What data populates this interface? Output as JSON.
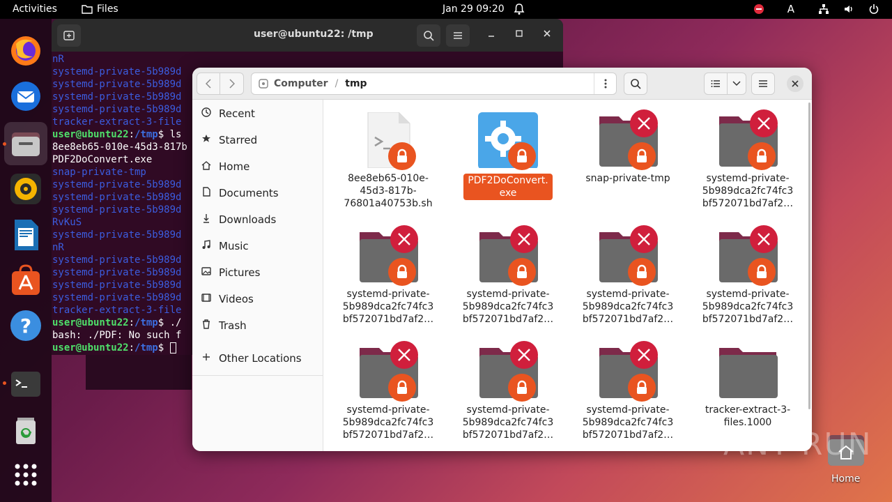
{
  "topbar": {
    "activities": "Activities",
    "app_name": "Files",
    "clock": "Jan 29  09:20",
    "input_indicator": "A"
  },
  "dock": {
    "items": [
      "firefox-icon",
      "thunderbird-icon",
      "files-icon",
      "rhythmbox-icon",
      "writer-icon",
      "app-center-icon",
      "help-icon",
      "terminal-icon",
      "trash-icon",
      "show-apps-icon"
    ]
  },
  "terminal": {
    "title": "user@ubuntu22: /tmp",
    "lines": [
      {
        "type": "blue",
        "text": "nR"
      },
      {
        "type": "blue",
        "text": "systemd-private-5b989d"
      },
      {
        "type": "blue",
        "text": "systemd-private-5b989d"
      },
      {
        "type": "blue",
        "text": "systemd-private-5b989d"
      },
      {
        "type": "blue",
        "text": "systemd-private-5b989d"
      },
      {
        "type": "blue",
        "text": "tracker-extract-3-file"
      },
      {
        "type": "prompt",
        "user": "user@ubuntu22",
        "path": "/tmp",
        "cmd": "$ ls"
      },
      {
        "type": "plain",
        "text": "8ee8eb65-010e-45d3-817b"
      },
      {
        "type": "plain",
        "text": "PDF2DoConvert.exe"
      },
      {
        "type": "blue",
        "text": "snap-private-tmp"
      },
      {
        "type": "blue",
        "text": "systemd-private-5b989d"
      },
      {
        "type": "blue",
        "text": "systemd-private-5b989d"
      },
      {
        "type": "blue",
        "text": "systemd-private-5b989d"
      },
      {
        "type": "blue",
        "text": "RvKuS"
      },
      {
        "type": "blue",
        "text": "systemd-private-5b989d"
      },
      {
        "type": "blue",
        "text": "nR"
      },
      {
        "type": "blue",
        "text": "systemd-private-5b989d"
      },
      {
        "type": "blue",
        "text": "systemd-private-5b989d"
      },
      {
        "type": "blue",
        "text": "systemd-private-5b989d"
      },
      {
        "type": "blue",
        "text": "systemd-private-5b989d"
      },
      {
        "type": "blue",
        "text": "tracker-extract-3-file"
      },
      {
        "type": "prompt",
        "user": "user@ubuntu22",
        "path": "/tmp",
        "cmd": "$ ./"
      },
      {
        "type": "plain",
        "text": "bash: ./PDF: No such f"
      },
      {
        "type": "prompt-cursor",
        "user": "user@ubuntu22",
        "path": "/tmp",
        "cmd": "$ "
      }
    ]
  },
  "files": {
    "path": {
      "root": "Computer",
      "current": "tmp"
    },
    "sidebar": [
      {
        "label": "Recent",
        "icon": "clock-icon"
      },
      {
        "label": "Starred",
        "icon": "star-icon"
      },
      {
        "label": "Home",
        "icon": "home-icon"
      },
      {
        "label": "Documents",
        "icon": "document-icon"
      },
      {
        "label": "Downloads",
        "icon": "download-icon"
      },
      {
        "label": "Music",
        "icon": "music-icon"
      },
      {
        "label": "Pictures",
        "icon": "picture-icon"
      },
      {
        "label": "Videos",
        "icon": "video-icon"
      },
      {
        "label": "Trash",
        "icon": "trash-icon"
      },
      {
        "label": "Other Locations",
        "icon": "plus-icon"
      }
    ],
    "items": [
      {
        "name": "8ee8eb65-010e-45d3-817b-76801a40753b.sh",
        "lines": [
          "8ee8eb65-010e-",
          "45d3-817b-",
          "76801a40753b.sh"
        ],
        "kind": "script",
        "locked": true,
        "denied": false,
        "selected": false
      },
      {
        "name": "PDF2DoConvert.exe",
        "lines": [
          "PDF2DoConvert.",
          "exe"
        ],
        "kind": "exe",
        "locked": true,
        "denied": false,
        "selected": true
      },
      {
        "name": "snap-private-tmp",
        "lines": [
          "snap-private-tmp"
        ],
        "kind": "folder",
        "locked": true,
        "denied": true,
        "selected": false
      },
      {
        "name": "systemd-private-5b989dca2fc74fc3bf572071bd7af2…",
        "lines": [
          "systemd-private-",
          "5b989dca2fc74fc3",
          "bf572071bd7af2…"
        ],
        "kind": "folder",
        "locked": true,
        "denied": true,
        "selected": false
      },
      {
        "name": "systemd-private-5b989dca2fc74fc3bf572071bd7af2…",
        "lines": [
          "systemd-private-",
          "5b989dca2fc74fc3",
          "bf572071bd7af2…"
        ],
        "kind": "folder",
        "locked": true,
        "denied": true,
        "selected": false
      },
      {
        "name": "systemd-private-5b989dca2fc74fc3bf572071bd7af2…",
        "lines": [
          "systemd-private-",
          "5b989dca2fc74fc3",
          "bf572071bd7af2…"
        ],
        "kind": "folder",
        "locked": true,
        "denied": true,
        "selected": false
      },
      {
        "name": "systemd-private-5b989dca2fc74fc3bf572071bd7af2…",
        "lines": [
          "systemd-private-",
          "5b989dca2fc74fc3",
          "bf572071bd7af2…"
        ],
        "kind": "folder",
        "locked": true,
        "denied": true,
        "selected": false
      },
      {
        "name": "systemd-private-5b989dca2fc74fc3bf572071bd7af2…",
        "lines": [
          "systemd-private-",
          "5b989dca2fc74fc3",
          "bf572071bd7af2…"
        ],
        "kind": "folder",
        "locked": true,
        "denied": true,
        "selected": false
      },
      {
        "name": "systemd-private-5b989dca2fc74fc3bf572071bd7af2…",
        "lines": [
          "systemd-private-",
          "5b989dca2fc74fc3",
          "bf572071bd7af2…"
        ],
        "kind": "folder",
        "locked": true,
        "denied": true,
        "selected": false
      },
      {
        "name": "systemd-private-5b989dca2fc74fc3bf572071bd7af2…",
        "lines": [
          "systemd-private-",
          "5b989dca2fc74fc3",
          "bf572071bd7af2…"
        ],
        "kind": "folder",
        "locked": true,
        "denied": true,
        "selected": false
      },
      {
        "name": "systemd-private-5b989dca2fc74fc3bf572071bd7af2…",
        "lines": [
          "systemd-private-",
          "5b989dca2fc74fc3",
          "bf572071bd7af2…"
        ],
        "kind": "folder",
        "locked": true,
        "denied": true,
        "selected": false
      },
      {
        "name": "tracker-extract-3-files.1000",
        "lines": [
          "tracker-extract-3-",
          "files.1000"
        ],
        "kind": "folder",
        "locked": false,
        "denied": false,
        "selected": false
      }
    ]
  },
  "desktop": {
    "home_label": "Home",
    "watermark": "ANY RUN"
  },
  "colors": {
    "accent": "#e95420",
    "denied": "#d01f3c",
    "terminal_bg": "#300a24"
  }
}
